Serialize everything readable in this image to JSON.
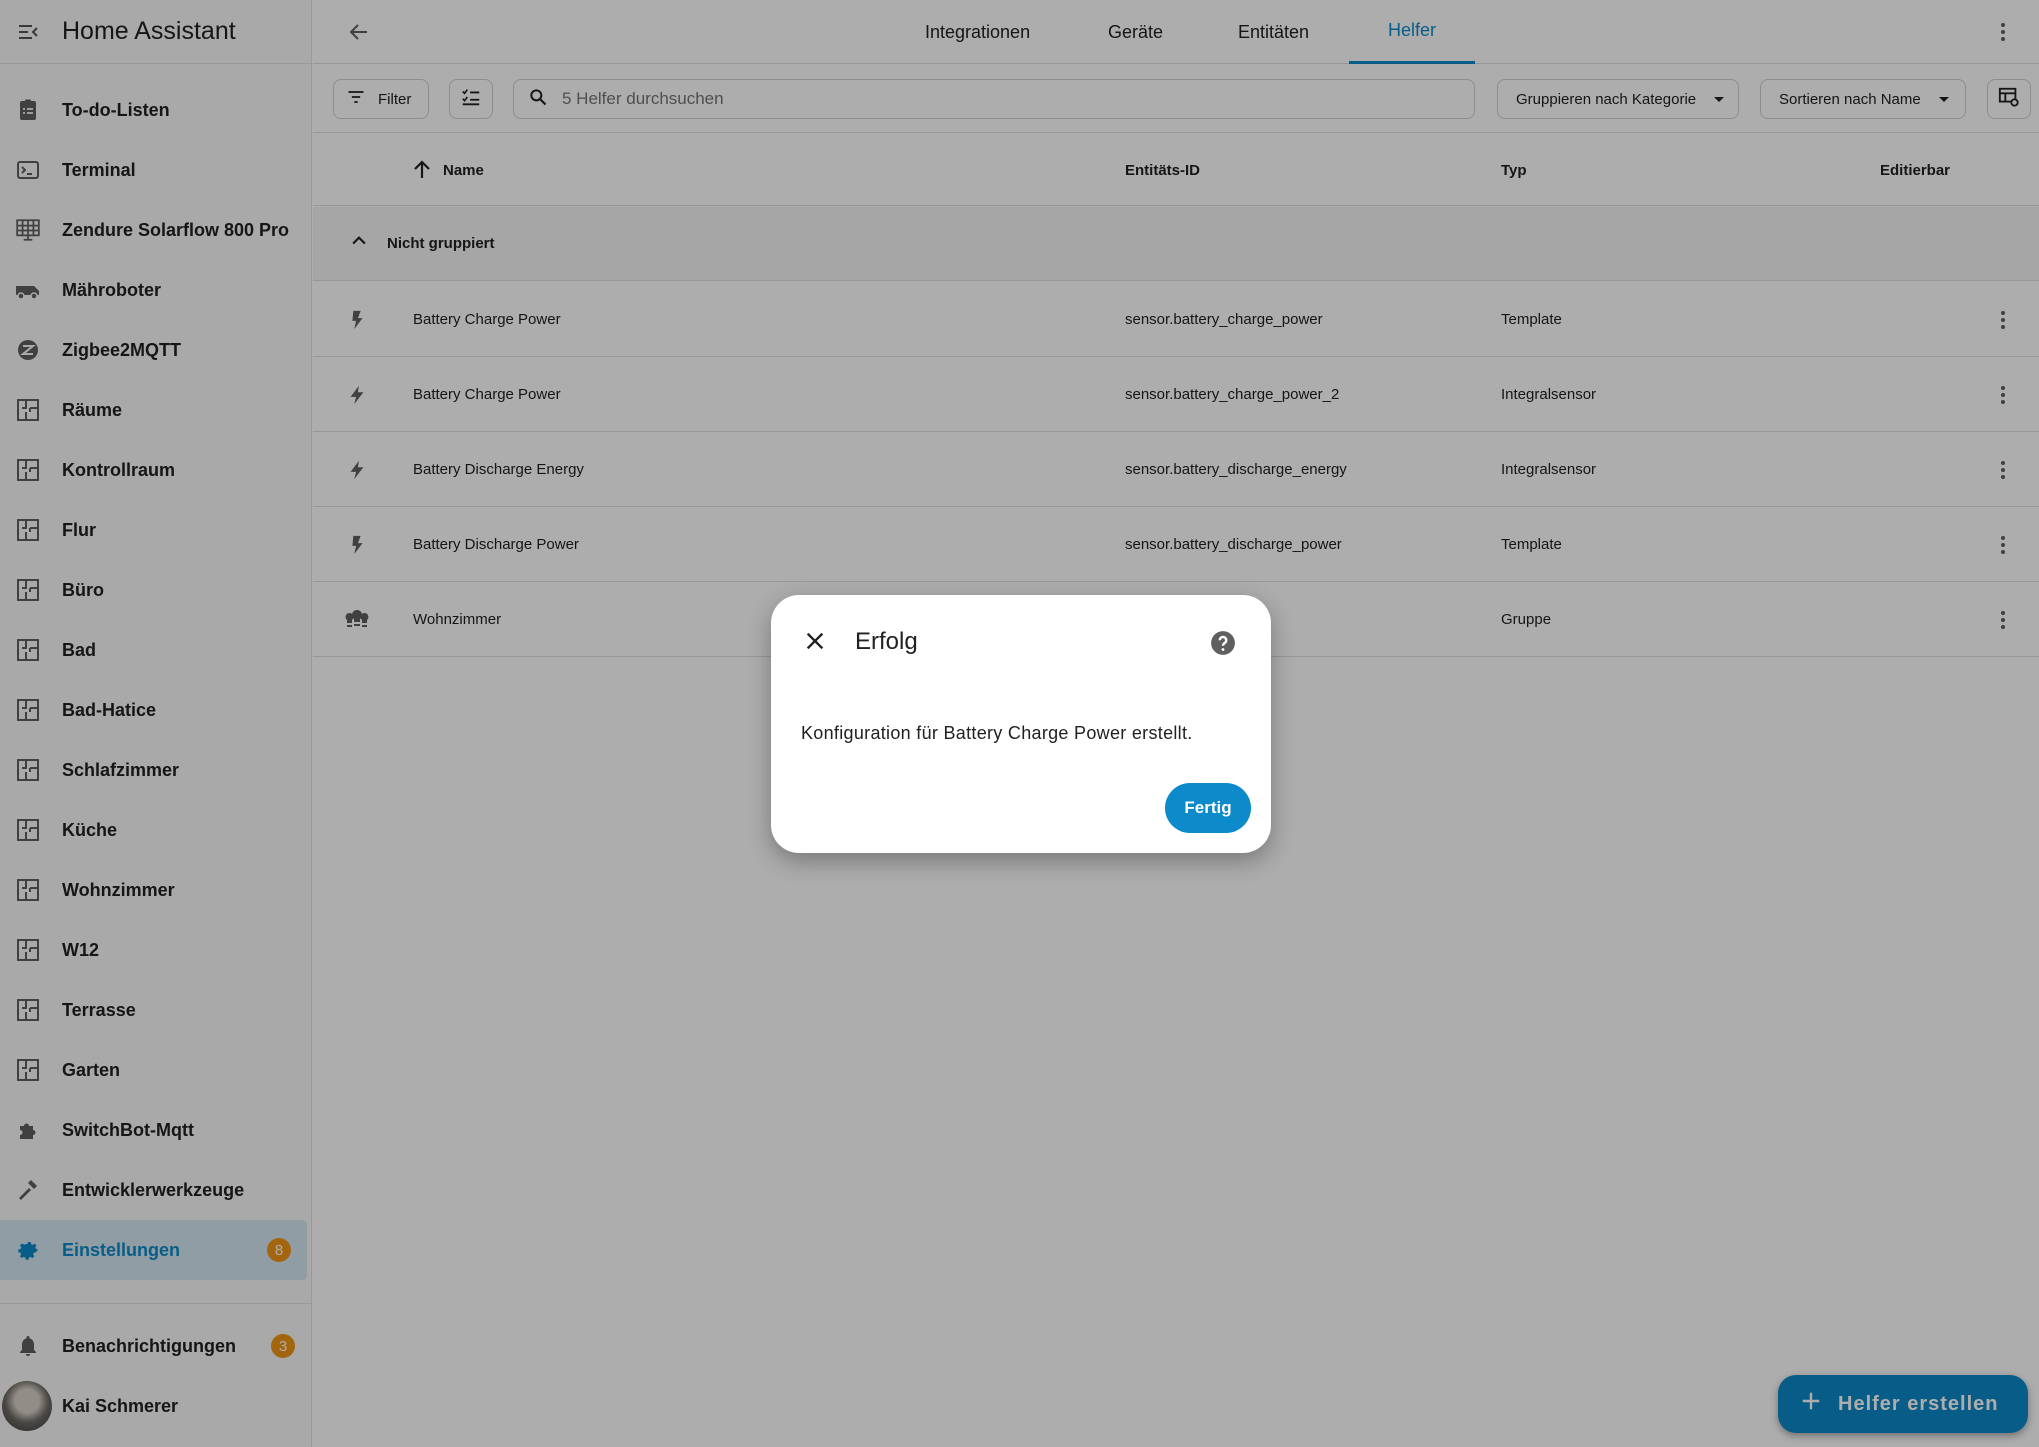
{
  "app": {
    "title": "Home Assistant"
  },
  "sidebar": {
    "items": [
      {
        "label": "To-do-Listen",
        "icon": "clipboard-list-icon"
      },
      {
        "label": "Terminal",
        "icon": "console-icon"
      },
      {
        "label": "Zendure Solarflow 800 Pro",
        "icon": "solar-panel-icon"
      },
      {
        "label": "Mähroboter",
        "icon": "robot-mower-icon"
      },
      {
        "label": "Zigbee2MQTT",
        "icon": "zigbee-icon"
      },
      {
        "label": "Räume",
        "icon": "floorplan-icon"
      },
      {
        "label": "Kontrollraum",
        "icon": "floorplan-icon"
      },
      {
        "label": "Flur",
        "icon": "floorplan-icon"
      },
      {
        "label": "Büro",
        "icon": "floorplan-icon"
      },
      {
        "label": "Bad",
        "icon": "floorplan-icon"
      },
      {
        "label": "Bad-Hatice",
        "icon": "floorplan-icon"
      },
      {
        "label": "Schlafzimmer",
        "icon": "floorplan-icon"
      },
      {
        "label": "Küche",
        "icon": "floorplan-icon"
      },
      {
        "label": "Wohnzimmer",
        "icon": "floorplan-icon"
      },
      {
        "label": "W12",
        "icon": "floorplan-icon"
      },
      {
        "label": "Terrasse",
        "icon": "floorplan-icon"
      },
      {
        "label": "Garten",
        "icon": "floorplan-icon"
      },
      {
        "label": "SwitchBot-Mqtt",
        "icon": "puzzle-icon"
      },
      {
        "label": "Entwicklerwerkzeuge",
        "icon": "hammer-icon"
      },
      {
        "label": "Einstellungen",
        "icon": "gear-icon",
        "badge": "8",
        "active": true
      }
    ],
    "notifications": {
      "label": "Benachrichtigungen",
      "badge": "3"
    },
    "user": {
      "label": "Kai Schmerer"
    }
  },
  "tabs": [
    {
      "label": "Integrationen"
    },
    {
      "label": "Geräte"
    },
    {
      "label": "Entitäten"
    },
    {
      "label": "Helfer",
      "active": true
    }
  ],
  "toolbar": {
    "filter_label": "Filter",
    "search_placeholder": "5 Helfer durchsuchen",
    "group_label": "Gruppieren nach Kategorie",
    "sort_label": "Sortieren nach Name"
  },
  "table": {
    "columns": {
      "name": "Name",
      "entity_id": "Entitäts-ID",
      "type": "Typ",
      "editable": "Editierbar"
    },
    "group_label": "Nicht gruppiert",
    "rows": [
      {
        "name": "Battery Charge Power",
        "entity_id": "sensor.battery_charge_power",
        "type": "Template",
        "icon": "flash-icon"
      },
      {
        "name": "Battery Charge Power",
        "entity_id": "sensor.battery_charge_power_2",
        "type": "Integralsensor",
        "icon": "flash-icon"
      },
      {
        "name": "Battery Discharge Energy",
        "entity_id": "sensor.battery_discharge_energy",
        "type": "Integralsensor",
        "icon": "flash-icon"
      },
      {
        "name": "Battery Discharge Power",
        "entity_id": "sensor.battery_discharge_power",
        "type": "Template",
        "icon": "flash-icon"
      },
      {
        "name": "Wohnzimmer",
        "entity_id": "",
        "type": "Gruppe",
        "icon": "lightbulb-group-icon"
      }
    ]
  },
  "fab": {
    "label": "Helfer erstellen"
  },
  "dialog": {
    "title": "Erfolg",
    "message": "Konfiguration für Battery Charge Power erstellt.",
    "button": "Fertig"
  },
  "colors": {
    "accent": "#0d8ac9",
    "badge": "#f09716"
  }
}
